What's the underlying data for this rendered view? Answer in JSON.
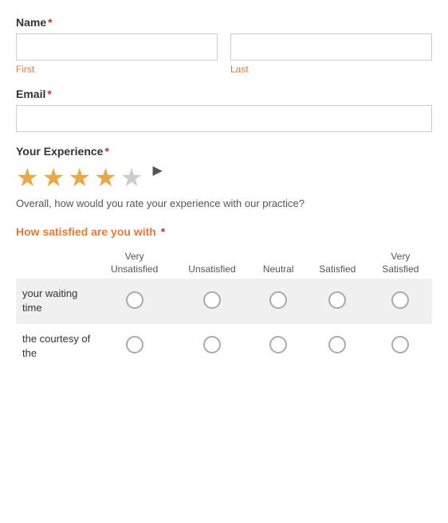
{
  "form": {
    "name_label": "Name",
    "name_required": "*",
    "first_label": "First",
    "last_label": "Last",
    "email_label": "Email",
    "email_required": "*",
    "experience_label": "Your Experience",
    "experience_required": "*",
    "experience_note": "Overall, how would you rate your experience with our practice?",
    "stars_filled": 4,
    "stars_total": 5,
    "satisfaction_label": "How satisfied are you with",
    "satisfaction_required": "*",
    "columns": [
      "Very\nUnsatisfied",
      "Unsatisfied",
      "Neutral",
      "Satisfied",
      "Very\nSatisfied"
    ],
    "rows": [
      {
        "label": "your waiting time"
      },
      {
        "label": "the courtesy of the"
      }
    ]
  }
}
